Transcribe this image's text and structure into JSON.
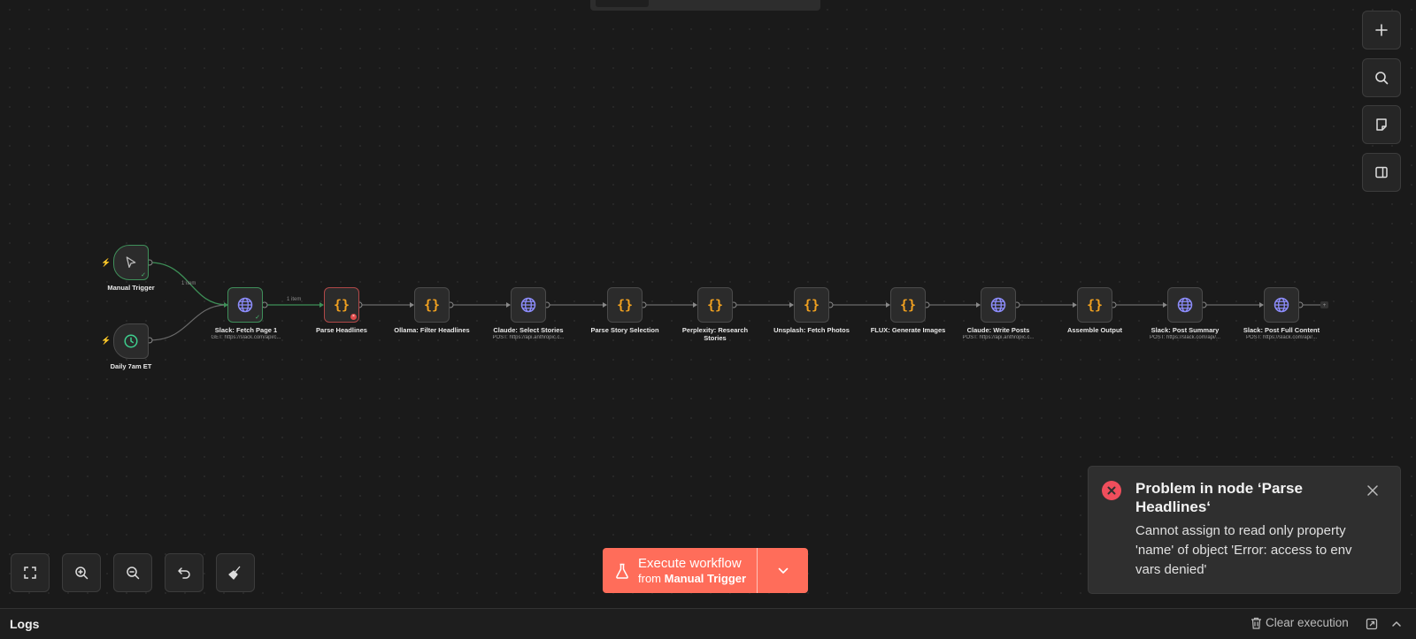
{
  "nodes": {
    "manual_trigger": {
      "label": "Manual Trigger"
    },
    "daily": {
      "label": "Daily 7am ET"
    },
    "fetch": {
      "label": "Slack: Fetch Page 1",
      "sub": "GET: https://slack.com/api/c..."
    },
    "parse_headlines": {
      "label": "Parse Headlines"
    },
    "ollama": {
      "label": "Ollama: Filter Headlines"
    },
    "claude_select": {
      "label": "Claude: Select Stories",
      "sub": "POST: https://api.anthropic.c..."
    },
    "parse_story": {
      "label": "Parse Story Selection"
    },
    "perplexity": {
      "label": "Perplexity: Research Stories"
    },
    "unsplash": {
      "label": "Unsplash: Fetch Photos"
    },
    "flux": {
      "label": "FLUX: Generate Images"
    },
    "claude_write": {
      "label": "Claude: Write Posts",
      "sub": "POST: https://api.anthropic.c..."
    },
    "assemble": {
      "label": "Assemble Output"
    },
    "post_summary": {
      "label": "Slack: Post Summary",
      "sub": "POST: https://slack.com/api/..."
    },
    "post_full": {
      "label": "Slack: Post Full Content",
      "sub": "POST: https://slack.com/api/..."
    }
  },
  "node_icons": {
    "trigger": "cursor-icon",
    "schedule": "clock-icon",
    "http": "globe-icon",
    "code": "{}"
  },
  "edges": {
    "label_trigger": "1 item",
    "label_fetch": "1 item"
  },
  "execute": {
    "title": "Execute workflow",
    "from_prefix": "from",
    "from_node": "Manual Trigger"
  },
  "toast": {
    "title": "Problem in node ‘Parse Headlines‘",
    "message": "Cannot assign to read only property 'name' of object 'Error: access to env vars denied'"
  },
  "logs": {
    "title": "Logs",
    "clear": "Clear execution"
  },
  "colors": {
    "accent": "#ff6d5a",
    "success": "#4cbf73",
    "error": "#f04e5c",
    "code": "#f0a020",
    "http": "#8d8dfc",
    "background": "#1a1a1a"
  }
}
